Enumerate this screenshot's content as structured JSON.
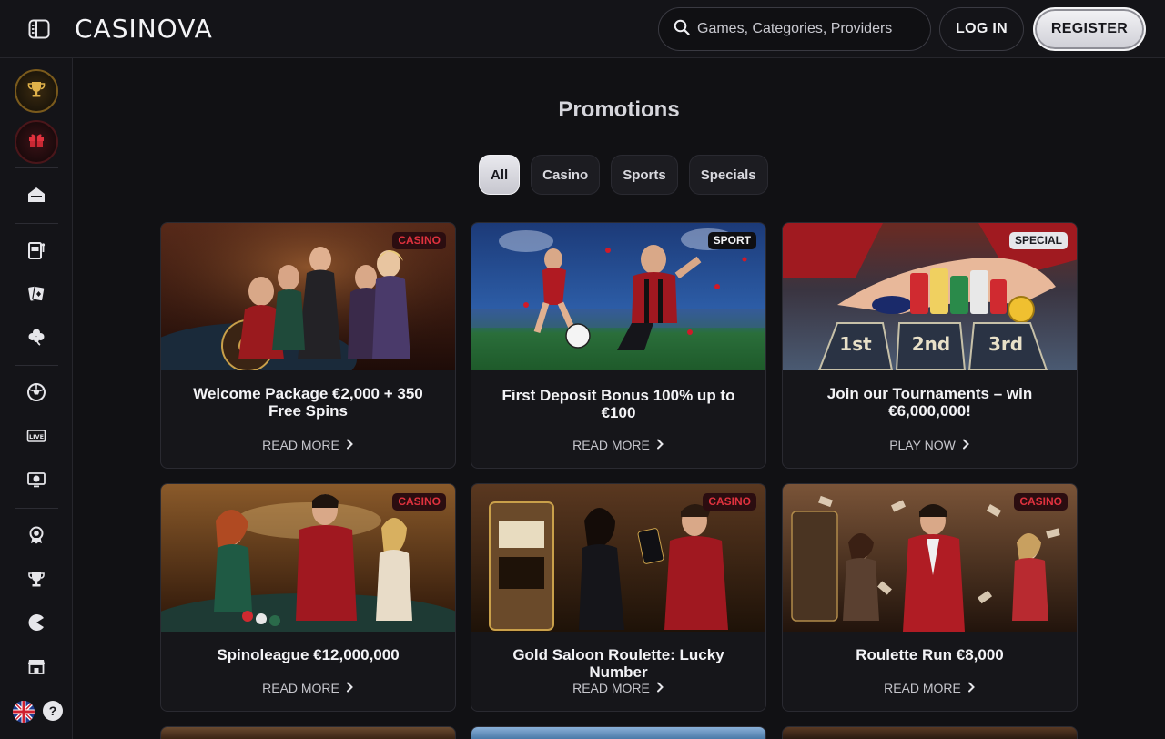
{
  "header": {
    "logo": "CASINOVA",
    "search_placeholder": "Games, Categories, Providers",
    "login_label": "LOG IN",
    "register_label": "REGISTER"
  },
  "sidebar": {
    "icons": [
      "trophy-icon",
      "gift-icon",
      "home-icon",
      "slot-machine-icon",
      "cards-icon",
      "clover-icon",
      "soccer-ball-icon",
      "live-icon",
      "virtual-sports-icon",
      "badge-icon",
      "cup-icon",
      "pacman-icon",
      "shop-icon"
    ],
    "help_label": "?"
  },
  "main": {
    "title": "Promotions",
    "filters": [
      {
        "label": "All",
        "active": true
      },
      {
        "label": "Casino",
        "active": false
      },
      {
        "label": "Sports",
        "active": false
      },
      {
        "label": "Specials",
        "active": false
      }
    ],
    "cards": [
      {
        "badge": "CASINO",
        "title": "Welcome Package €2,000 + 350 Free Spins",
        "action": "READ MORE"
      },
      {
        "badge": "SPORT",
        "title": "First Deposit Bonus 100% up to €100",
        "action": "READ MORE"
      },
      {
        "badge": "SPECIAL",
        "title": "Join our Tournaments – win €6,000,000!",
        "action": "PLAY NOW"
      },
      {
        "badge": "CASINO",
        "title": "Spinoleague €12,000,000",
        "action": "READ MORE"
      },
      {
        "badge": "CASINO",
        "title": "Gold Saloon Roulette: Lucky Number",
        "action": "READ MORE"
      },
      {
        "badge": "CASINO",
        "title": "Roulette Run €8,000",
        "action": "READ MORE"
      }
    ]
  },
  "colors": {
    "background": "#111114",
    "casino_badge": "#e0323e",
    "accent_gold": "#c9a04a"
  }
}
